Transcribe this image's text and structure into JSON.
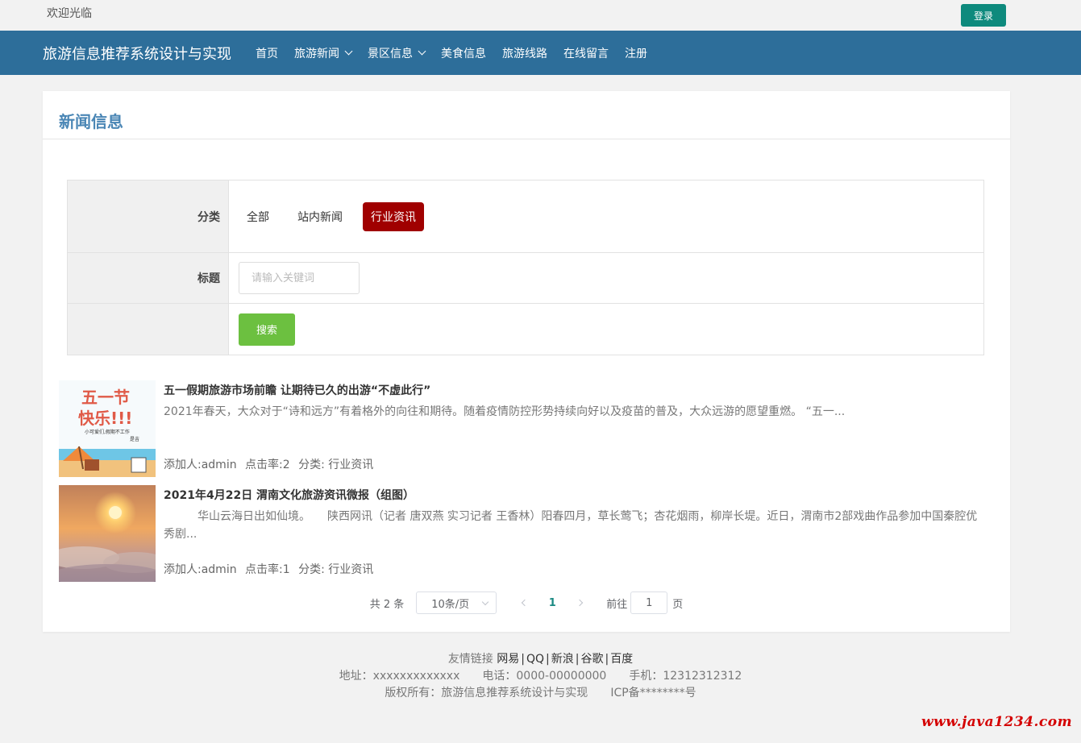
{
  "topbar": {
    "welcome": "欢迎光临",
    "login_label": "登录"
  },
  "navbar": {
    "brand": "旅游信息推荐系统设计与实现",
    "items": [
      {
        "label": "首页",
        "dropdown": false
      },
      {
        "label": "旅游新闻",
        "dropdown": true
      },
      {
        "label": "景区信息",
        "dropdown": true
      },
      {
        "label": "美食信息",
        "dropdown": false
      },
      {
        "label": "旅游线路",
        "dropdown": false
      },
      {
        "label": "在线留言",
        "dropdown": false
      },
      {
        "label": "注册",
        "dropdown": false
      }
    ]
  },
  "panel": {
    "title": "新闻信息"
  },
  "filter": {
    "category_label": "分类",
    "categories": [
      {
        "label": "全部",
        "active": false
      },
      {
        "label": "站内新闻",
        "active": false
      },
      {
        "label": "行业资讯",
        "active": true
      }
    ],
    "title_label": "标题",
    "keyword_placeholder": "请输入关键词",
    "keyword_value": "",
    "search_label": "搜索"
  },
  "news": [
    {
      "title": "五一假期旅游市场前瞻 让期待已久的出游“不虚此行”",
      "summary": "2021年春天，大众对于“诗和远方”有着格外的向往和期待。随着疫情防控形势持续向好以及疫苗的普及，大众远游的愿望重燃。 “五一...",
      "author": "添加人:admin",
      "clicks": "点击率:2",
      "category": "分类: 行业资讯",
      "thumb_text": {
        "line1": "五一节",
        "line2": "快乐!!!",
        "line3": "小可爱们,假期不工作",
        "line4": "是吉"
      }
    },
    {
      "title": "2021年4月22日 渭南文化旅游资讯微报（组图）",
      "summary": "　　　华山云海日出如仙境。　　陕西网讯（记者 唐双燕 实习记者 王香林）阳春四月，草长莺飞；杏花烟雨，柳岸长堤。近日，渭南市2部戏曲作品参加中国秦腔优秀剧...",
      "author": "添加人:admin",
      "clicks": "点击率:1",
      "category": "分类: 行业资讯"
    }
  ],
  "pagination": {
    "total": "共 2 条",
    "page_size": "10条/页",
    "current_page": "1",
    "goto_prefix": "前往",
    "goto_value": "1",
    "goto_suffix": "页"
  },
  "footer": {
    "links_label": "友情链接",
    "links": [
      "网易",
      "QQ",
      "新浪",
      "谷歌",
      "百度"
    ],
    "address": "地址：xxxxxxxxxxxxx",
    "phone": "电话：0000-00000000",
    "mobile": "手机：12312312312",
    "copyright": "版权所有：旅游信息推荐系统设计与实现",
    "icp": "ICP备********号"
  },
  "watermark": "www.java1234.com",
  "colors": {
    "navbar": "#2d6e9a",
    "login": "#0e8a7d",
    "active_category": "#a00000",
    "search": "#6cc040",
    "panel_title": "#4a86b5"
  }
}
